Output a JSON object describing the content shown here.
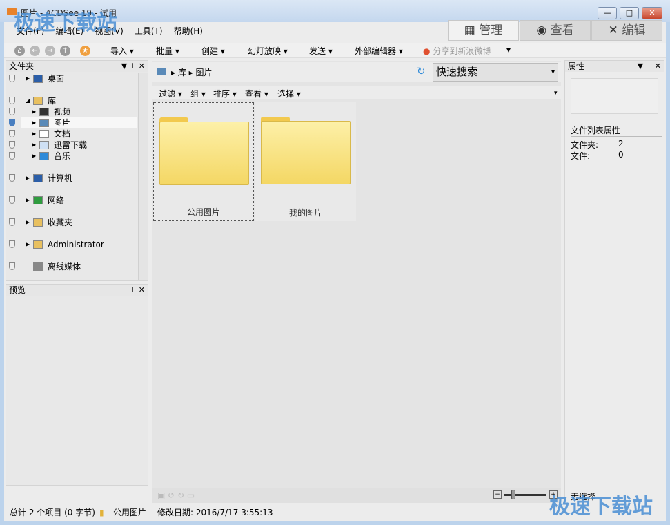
{
  "window": {
    "title": "图片 - ACDSee 19 - 试用"
  },
  "menu": [
    "文件(F)",
    "编辑(E)",
    "视图(V)",
    "工具(T)",
    "帮助(H)"
  ],
  "modes": [
    {
      "label": "管理",
      "icon": "grid-icon"
    },
    {
      "label": "查看",
      "icon": "eye-icon"
    },
    {
      "label": "编辑",
      "icon": "tools-icon"
    }
  ],
  "toolbar": [
    "导入",
    "批量",
    "创建",
    "幻灯放映",
    "发送",
    "外部编辑器"
  ],
  "share": "分享到新浪微博",
  "folders_panel": {
    "title": "文件夹",
    "items": [
      "桌面",
      "库",
      "视频",
      "图片",
      "文档",
      "迅雷下载",
      "音乐",
      "计算机",
      "网络",
      "收藏夹",
      "Administrator",
      "离线媒体"
    ]
  },
  "preview_panel": {
    "title": "预览"
  },
  "breadcrumb": [
    "库",
    "图片"
  ],
  "search": {
    "value": "快速搜索"
  },
  "filterbar": [
    "过滤",
    "组",
    "排序",
    "查看",
    "选择"
  ],
  "thumbnails": [
    "公用图片",
    "我的图片"
  ],
  "properties": {
    "title": "属性",
    "section": "文件列表属性",
    "rows": [
      {
        "k": "文件夹:",
        "v": "2"
      },
      {
        "k": "文件:",
        "v": "0"
      }
    ],
    "selection": "无选择"
  },
  "status": {
    "total": "总计 2 个项目 (0 字节)",
    "folder": "公用图片",
    "modified": "修改日期: 2016/7/17 3:55:13"
  },
  "watermark": "极速下载站"
}
